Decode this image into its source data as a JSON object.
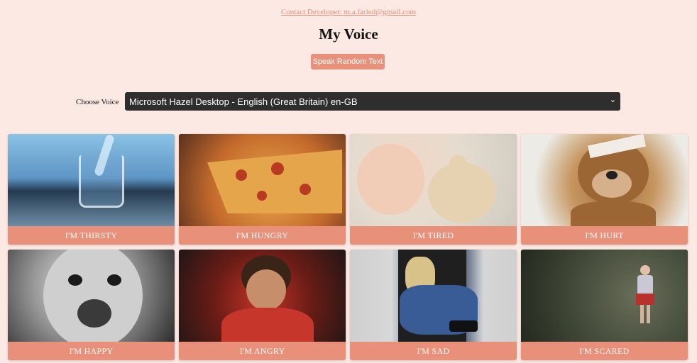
{
  "header": {
    "contact_link": "Contact Developer: m.a.faried@gmail.com",
    "title": "My Voice",
    "speak_button": "Speak Random Text"
  },
  "voice": {
    "label": "Choose Voice",
    "selected": "Microsoft Hazel Desktop - English (Great Britain) en-GB",
    "chevron_icon": "chevron-down-icon"
  },
  "cards": [
    {
      "label": "I'M THIRSTY",
      "image": "glass of water splash"
    },
    {
      "label": "I'M HUNGRY",
      "image": "pizza slice"
    },
    {
      "label": "I'M TIRED",
      "image": "sleeping child with teddy"
    },
    {
      "label": "I'M HURT",
      "image": "bandaged teddy bear"
    },
    {
      "label": "I'M HAPPY",
      "image": "excited boy face"
    },
    {
      "label": "I'M ANGRY",
      "image": "angry child in red"
    },
    {
      "label": "I'M SAD",
      "image": "sad child sitting in doorway"
    },
    {
      "label": "I'M SCARED",
      "image": "child standing alone in forest"
    }
  ],
  "colors": {
    "background": "#fde9e4",
    "accent": "#e8907a",
    "select_bg": "#2e2e2e"
  }
}
